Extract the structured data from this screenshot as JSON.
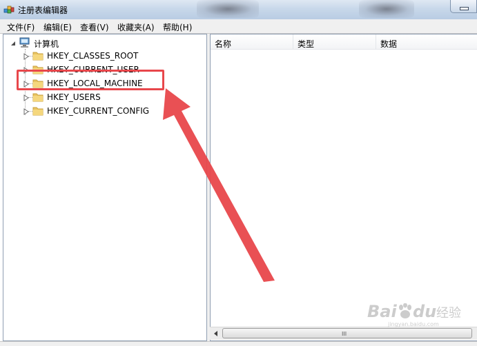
{
  "window": {
    "title": "注册表编辑器",
    "icon": "regedit-icon"
  },
  "menu": [
    "文件(F)",
    "编辑(E)",
    "查看(V)",
    "收藏夹(A)",
    "帮助(H)"
  ],
  "tree": {
    "root": "计算机",
    "items": [
      {
        "label": "HKEY_CLASSES_ROOT",
        "highlighted": false
      },
      {
        "label": "HKEY_CURRENT_USER",
        "highlighted": false
      },
      {
        "label": "HKEY_LOCAL_MACHINE",
        "highlighted": true
      },
      {
        "label": "HKEY_USERS",
        "highlighted": false
      },
      {
        "label": "HKEY_CURRENT_CONFIG",
        "highlighted": false
      }
    ]
  },
  "columns": [
    "名称",
    "类型",
    "数据"
  ],
  "scrollbar": {
    "grip": "III"
  },
  "annotation": {
    "color": "#e8474b"
  },
  "watermark": {
    "brand": "Bai",
    "brand2": "du",
    "suffix": "经验",
    "url": "jingyan.baidu.com"
  },
  "colors": {
    "folder": "#e9c463",
    "folder_dark": "#c9a23e",
    "accent_red": "#e8474b"
  }
}
